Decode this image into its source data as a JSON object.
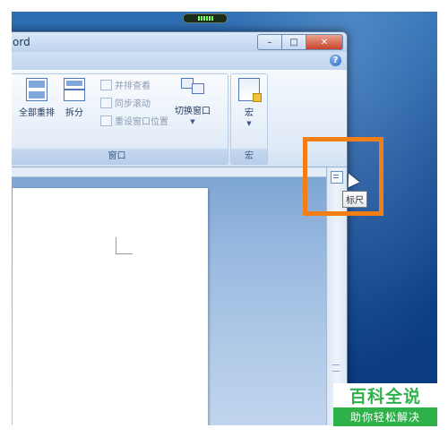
{
  "window": {
    "title_fragment": "ord",
    "caption": {
      "minimize": "–",
      "maximize": "□",
      "close": "✕"
    },
    "help": "?"
  },
  "ribbon": {
    "window_group": {
      "label": "窗口",
      "new_window_fragment": "口",
      "arrange_all": "全部重排",
      "split": "拆分",
      "view_side_by_side": "并排查看",
      "sync_scroll": "同步滚动",
      "reset_window_position": "重设窗口位置",
      "switch_windows": "切换窗口"
    },
    "macro_group": {
      "label": "宏",
      "macro": "宏"
    }
  },
  "tooltip": {
    "ruler": "标尺"
  },
  "colors": {
    "highlight": "#f27f16",
    "watermark_green": "#2fb14a"
  },
  "watermark": {
    "top": "百科全说",
    "bottom": "助你轻松解决"
  }
}
